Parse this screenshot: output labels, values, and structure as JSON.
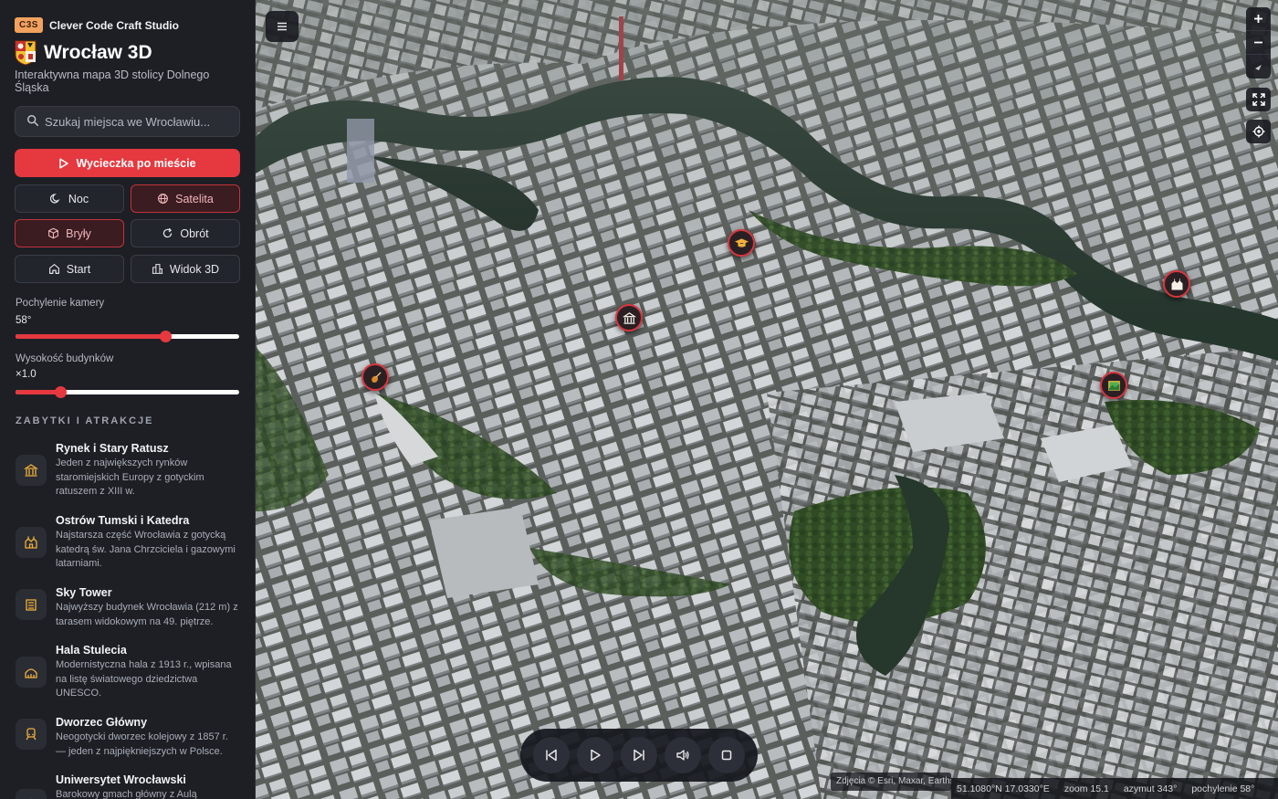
{
  "brand": {
    "badge": "C3S",
    "name": "Clever Code Craft Studio"
  },
  "header": {
    "title": "Wrocław 3D",
    "subtitle": "Interaktywna mapa 3D stolicy Dolnego Śląska"
  },
  "search": {
    "placeholder": "Szukaj miejsca we Wrocławiu..."
  },
  "buttons": {
    "tour": "Wycieczka po mieście",
    "night": "Noc",
    "satellite": "Satelita",
    "solids": "Bryły",
    "rotate": "Obrót",
    "start": "Start",
    "view3d": "Widok 3D"
  },
  "sliders": {
    "tilt": {
      "label": "Pochylenie kamery",
      "value": "58°",
      "fraction": 0.67
    },
    "height": {
      "label": "Wysokość budynków",
      "value": "×1.0",
      "fraction": 0.2
    }
  },
  "poi_section": "ZABYTKI I ATRAKCJE",
  "pois": [
    {
      "name": "Rynek i Stary Ratusz",
      "desc": "Jeden z największych rynków staromiejskich Europy z gotyckim ratuszem z XIII w.",
      "icon": "town-hall-icon"
    },
    {
      "name": "Ostrów Tumski i Katedra",
      "desc": "Najstarsza część Wrocławia z gotycką katedrą św. Jana Chrzciciela i gazowymi latarniami.",
      "icon": "cathedral-icon"
    },
    {
      "name": "Sky Tower",
      "desc": "Najwyższy budynek Wrocławia (212 m) z tarasem widokowym na 49. piętrze.",
      "icon": "tower-icon"
    },
    {
      "name": "Hala Stulecia",
      "desc": "Modernistyczna hala z 1913 r., wpisana na listę światowego dziedzictwa UNESCO.",
      "icon": "hall-icon"
    },
    {
      "name": "Dworzec Główny",
      "desc": "Neogotycki dworzec kolejowy z 1857 r. — jeden z najpiękniejszych w Polsce.",
      "icon": "station-icon"
    },
    {
      "name": "Uniwersytet Wrocławski",
      "desc": "Barokowy gmach główny z Aulą",
      "icon": "university-icon"
    }
  ],
  "map": {
    "attribution": "Zdjęcia © Esri, Maxar, Earthstar Geographics",
    "coords": "51.1080°N 17.0330°E",
    "zoom": "zoom 15.1",
    "azimuth": "azymut 343°",
    "tilt": "pochylenie 58°"
  },
  "colors": {
    "accent": "#e5383f",
    "sidebar": "#1d1f25",
    "badge": "#f2a25e"
  }
}
